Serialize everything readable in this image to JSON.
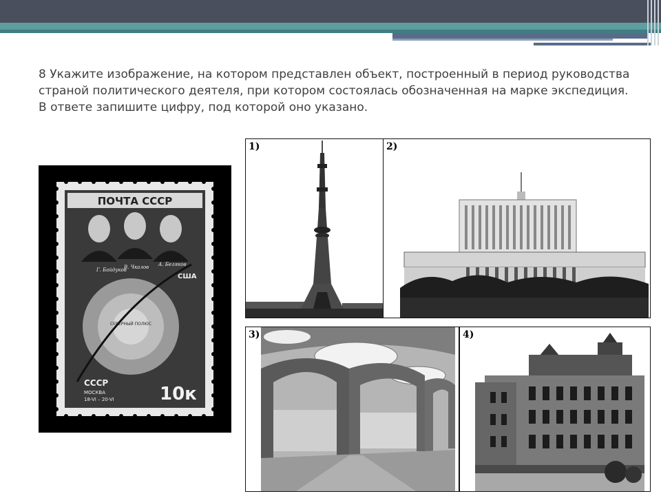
{
  "question": {
    "number": "8",
    "text": "Укажите изображение, на котором представлен объект, построенный в период руководства страной политического деятеля, при котором состоялась обозначенная на марке экспедиция. В ответе запишите цифру, под которой оно указано."
  },
  "stamp": {
    "header": "ПОЧТА СССР",
    "signatures": [
      "Г. Байдуков",
      "В. Чкалов",
      "А. Беляков"
    ],
    "country_label": "США",
    "pole_label": "СЕВЕРНЫЙ ПОЛЮС",
    "bottom_left_country": "СССР",
    "city": "МОСКВА",
    "dates": "18-VI – 20-VI",
    "value": "10к"
  },
  "images": [
    {
      "label": "1)"
    },
    {
      "label": "2)"
    },
    {
      "label": "3)"
    },
    {
      "label": "4)"
    }
  ],
  "colors": {
    "header_dark": "#4a4f5e",
    "header_teal": "#5f9e9e",
    "header_blue": "#5a6b8a",
    "text": "#404040"
  }
}
